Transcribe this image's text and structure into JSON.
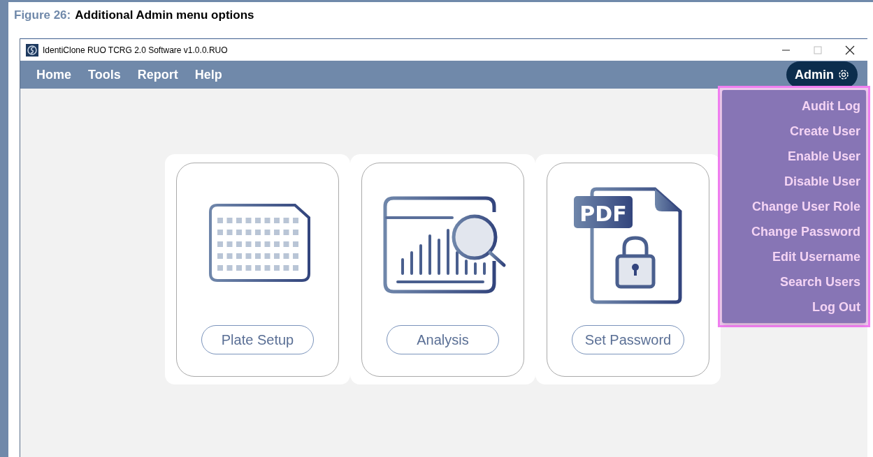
{
  "figure": {
    "label": "Figure 26:",
    "title": "Additional Admin menu options"
  },
  "window": {
    "title": "IdentiClone RUO TCRG 2.0 Software v1.0.0.RUO"
  },
  "menu_bar": [
    {
      "label": "Home"
    },
    {
      "label": "Tools"
    },
    {
      "label": "Report"
    },
    {
      "label": "Help"
    }
  ],
  "admin_button": {
    "label": "Admin",
    "expanded": true
  },
  "admin_menu": [
    {
      "label": "Audit Log"
    },
    {
      "label": "Create User"
    },
    {
      "label": "Enable User"
    },
    {
      "label": "Disable User"
    },
    {
      "label": "Change User Role"
    },
    {
      "label": "Change Password"
    },
    {
      "label": "Edit Username"
    },
    {
      "label": "Search Users"
    },
    {
      "label": "Log Out"
    }
  ],
  "cards": [
    {
      "kind": "plate",
      "button": "Plate Setup"
    },
    {
      "kind": "analysis",
      "button": "Analysis"
    },
    {
      "kind": "pdf",
      "button": "Set Password",
      "badge": "PDF"
    }
  ]
}
